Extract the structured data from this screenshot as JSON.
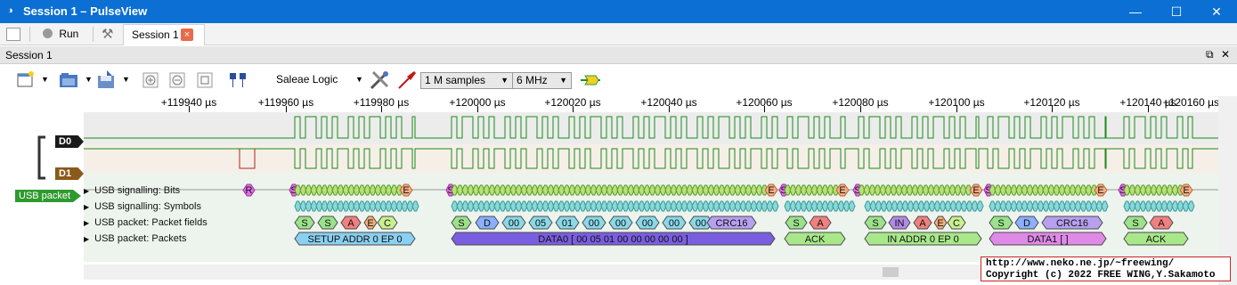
{
  "window": {
    "title": "Session 1 – PulseView",
    "minimize": "—",
    "maximize": "☐",
    "close": "✕"
  },
  "tabbar": {
    "run_label": "Run",
    "session_tab_label": "Session 1",
    "session_tab_close": "×"
  },
  "dock": {
    "title": "Session 1",
    "float": "⧉",
    "close": "✕"
  },
  "toolbar": {
    "device": "Saleae Logic",
    "samples": "1 M samples",
    "samplerate": "6 MHz"
  },
  "ruler": {
    "unit": "µs",
    "ticks": [
      "+119940 µs",
      "+119960 µs",
      "+119980 µs",
      "+120000 µs",
      "+120020 µs",
      "+120040 µs",
      "+120060 µs",
      "+120080 µs",
      "+120100 µs",
      "+120120 µs",
      "+120140 µs",
      "+120160 µs"
    ]
  },
  "channels": [
    {
      "name": "D0",
      "color": "#1f1f1f"
    },
    {
      "name": "D1",
      "color": "#8a5a1a"
    }
  ],
  "decoder": {
    "name": "USB packet",
    "color": "#2e9a2e",
    "rows": [
      "USB signalling: Bits",
      "USB signalling: Symbols",
      "USB packet: Packet fields",
      "USB packet: Packets"
    ]
  },
  "annotations": {
    "bits": [
      "R",
      "S",
      "E",
      "S",
      "E",
      "S",
      "E",
      "S",
      "E",
      "S",
      "E",
      "S",
      "E"
    ],
    "fields": [
      [
        "S",
        "S",
        "A",
        "E",
        "C"
      ],
      [
        "S",
        "D",
        "00",
        "05",
        "01",
        "00",
        "00",
        "00",
        "00",
        "00",
        "CRC16"
      ],
      [
        "S",
        "A"
      ],
      [
        "S",
        "IN",
        "A",
        "E",
        "C"
      ],
      [
        "S",
        "D",
        "CRC16"
      ],
      [
        "S",
        "A"
      ]
    ],
    "packets": [
      "SETUP ADDR 0 EP 0",
      "DATA0 [ 00 05 01 00 00 00 00 00 ]",
      "ACK",
      "IN ADDR 0 EP 0",
      "DATA1 [ ]",
      "ACK"
    ]
  },
  "copyright": {
    "line1": "http://www.neko.ne.jp/~freewing/",
    "line2": "Copyright (c) 2022 FREE WING,Y.Sakamoto"
  }
}
